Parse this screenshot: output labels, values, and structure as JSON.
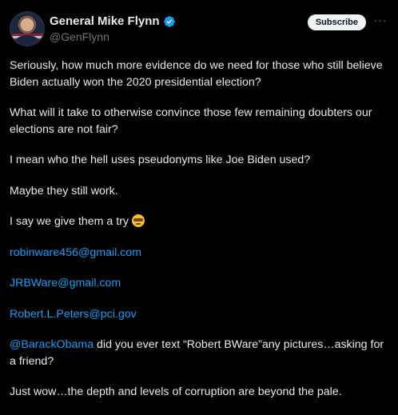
{
  "author": {
    "display_name": "General Mike Flynn",
    "handle": "@GenFlynn",
    "verified_icon": "verified-badge-icon",
    "avatar_icon": "avatar"
  },
  "actions": {
    "subscribe_label": "Subscribe",
    "more_label": "···"
  },
  "post": {
    "p1": "Seriously, how much more evidence do we need for those who still believe Biden actually won the 2020 presidential election?",
    "p2": "What will it take to otherwise convince those few remaining doubters our elections are not fair?",
    "p3": "I mean who the hell uses pseudonyms like  Joe Biden used?",
    "p4": " Maybe they still work.",
    "p5_text": "I say we give them a try ",
    "p5_emoji": "nerd-face-emoji",
    "email1": "robinware456@gmail.com",
    "email2": "JRBWare@gmail.com",
    "email3": "Robert.L.Peters@pci.gov",
    "mention": "@BarackObama",
    "p9_text": " did you ever text “Robert BWare”any pictures…asking for a friend?",
    "p10": "Just wow…the depth and levels of corruption are beyond the pale."
  },
  "colors": {
    "background": "#000000",
    "text": "#e7e9ea",
    "link": "#1d9bf0",
    "secondary": "#71767b",
    "verified": "#1d9bf0"
  }
}
